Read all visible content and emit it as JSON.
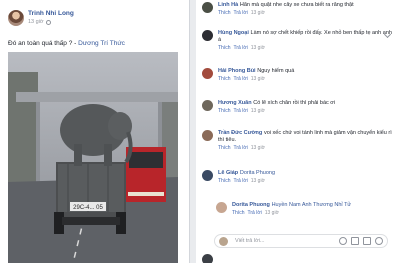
{
  "post": {
    "author": "Trinh Nhi Long",
    "time": "13 giờ",
    "text": "Đó an toàn quá thấp ?",
    "tag_separator": " - ",
    "tag": "Dương Trí Thức",
    "photo": {
      "plate": "29C-4... 05"
    }
  },
  "comments": [
    {
      "name": "Linh Hà",
      "text": "Hãn mà quặt nhe cây xe chưa biết ra răng thật",
      "like": "Thích",
      "reply": "Trả lời",
      "time": "13 giờ"
    },
    {
      "name": "Hùng Ngoại",
      "text": "Làm nó sợ chết khiếp rồi đấy. Xe nhỏ ben thấp tẹ anh anh á",
      "like": "Thích",
      "reply": "Trả lời",
      "time": "13 giờ"
    },
    {
      "name": "Hải Phong Bùi",
      "text": "Nguy hiểm quá",
      "like": "Thích",
      "reply": "Trả lời",
      "time": "13 giờ"
    },
    {
      "name": "Hương Xuân",
      "text": "Có lẽ xích chân rồi thì phải bác ơi",
      "like": "Thích",
      "reply": "Trả lời",
      "time": "13 giờ"
    },
    {
      "name": "Trần Đức Cường",
      "text": "voi xếc chứ voi tánh linh mà giảm vận chuyển kiểu rì thì tiêu.",
      "like": "Thích",
      "reply": "Trả lời",
      "time": "13 giờ"
    },
    {
      "name": "Lê Giáp",
      "text": "Dorita Phuong",
      "like": "Thích",
      "reply": "Trả lời",
      "time": "13 giờ"
    }
  ],
  "nested_reply": {
    "name": "Dorita Phuong",
    "text": "Huyền Nam Anh Thương Nhỉ Tử",
    "like": "Thích",
    "reply": "Trả lời",
    "time": "13 giờ"
  },
  "reply_box": {
    "placeholder": "Viết trả lời..."
  },
  "colors": {
    "link": "#365899",
    "meta": "#90949c",
    "background": "#e9ebee"
  }
}
